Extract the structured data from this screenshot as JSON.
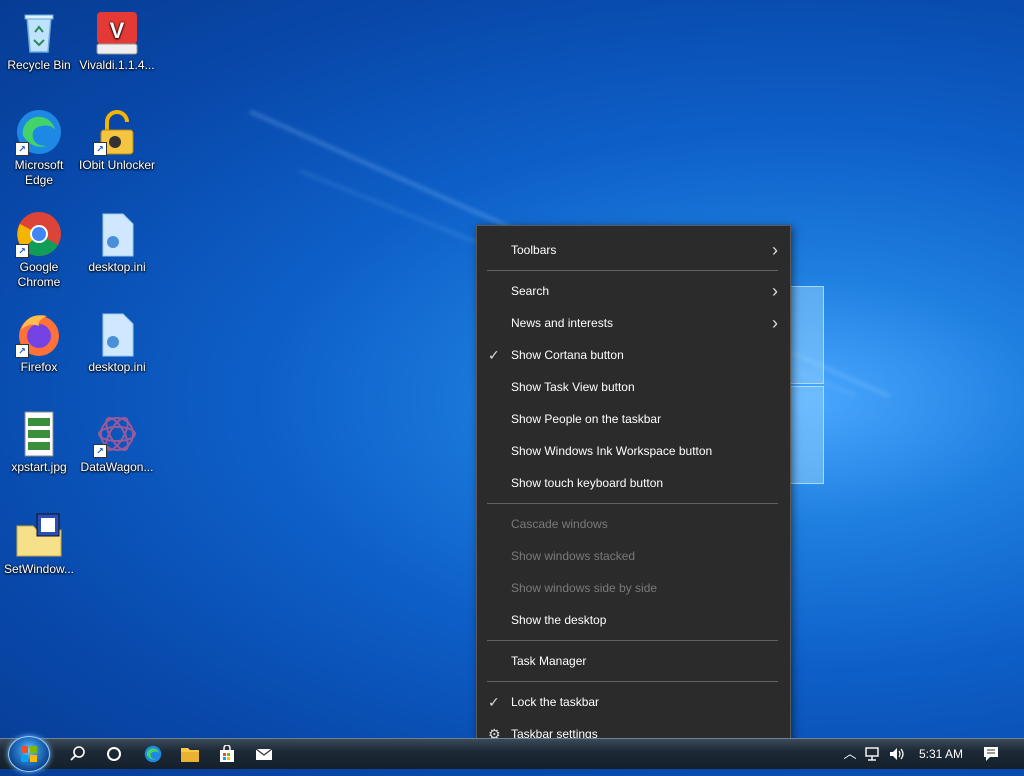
{
  "desktop": {
    "icons": [
      {
        "label": "Recycle Bin"
      },
      {
        "label": "Vivaldi.1.1.4..."
      },
      {
        "label": "Microsoft Edge"
      },
      {
        "label": "IObit Unlocker"
      },
      {
        "label": "Google Chrome"
      },
      {
        "label": "desktop.ini"
      },
      {
        "label": "Firefox"
      },
      {
        "label": "desktop.ini"
      },
      {
        "label": "xpstart.jpg"
      },
      {
        "label": "DataWagon..."
      },
      {
        "label": "SetWindow..."
      }
    ]
  },
  "context_menu": {
    "items": [
      {
        "label": "Toolbars",
        "submenu": true
      },
      {
        "label": "Search",
        "submenu": true
      },
      {
        "label": "News and interests",
        "submenu": true
      },
      {
        "label": "Show Cortana button",
        "checked": true
      },
      {
        "label": "Show Task View button"
      },
      {
        "label": "Show People on the taskbar"
      },
      {
        "label": "Show Windows Ink Workspace button"
      },
      {
        "label": "Show touch keyboard button"
      },
      {
        "label": "Cascade windows",
        "disabled": true
      },
      {
        "label": "Show windows stacked",
        "disabled": true
      },
      {
        "label": "Show windows side by side",
        "disabled": true
      },
      {
        "label": "Show the desktop"
      },
      {
        "label": "Task Manager"
      },
      {
        "label": "Lock the taskbar",
        "checked": true
      },
      {
        "label": "Taskbar settings",
        "icon": "gear-icon"
      }
    ]
  },
  "taskbar": {
    "clock": "5:31 AM",
    "pinned": [
      "search-icon",
      "cortana-icon",
      "edge-icon",
      "file-explorer-icon",
      "store-icon",
      "mail-icon"
    ],
    "tray": [
      "chevron-up-icon",
      "network-icon",
      "volume-icon",
      "notification-icon"
    ]
  },
  "colors": {
    "menu_bg": "#2b2b2b",
    "menu_disabled_text": "#7a7a7a",
    "desktop_blue": "#0d5fc8"
  }
}
